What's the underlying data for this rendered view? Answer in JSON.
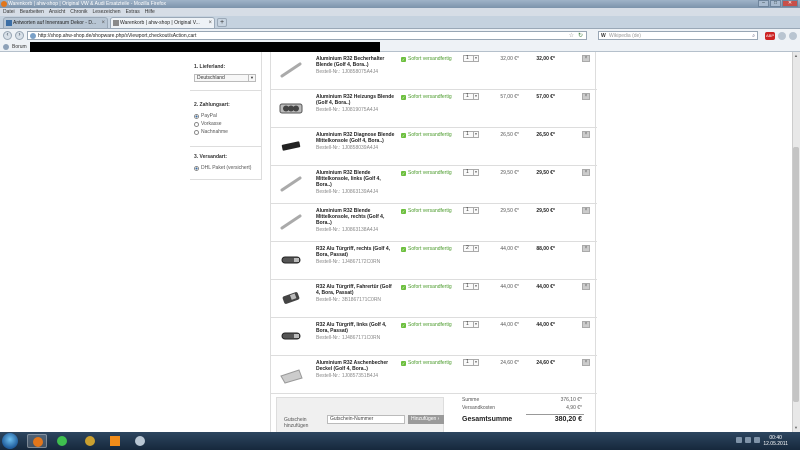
{
  "window": {
    "title": "Warenkorb | ahw-shop | Original VW & Audi Ersatzteile - Mozilla Firefox",
    "controls": [
      "–",
      "□",
      "✕"
    ]
  },
  "menubar": [
    "Datei",
    "Bearbeiten",
    "Ansicht",
    "Chronik",
    "Lesezeichen",
    "Extras",
    "Hilfe"
  ],
  "tabs": [
    {
      "label": "Antworten auf Innenraum Dekor - D...",
      "active": false
    },
    {
      "label": "Warenkorb | ahw-shop | Original V...",
      "active": true
    }
  ],
  "nav": {
    "url": "http://shop.ahw-shop.de/shopware.php/sViewport,checkout/sAction,cart",
    "search_placeholder": "Wikipedia (de)",
    "search_prefix": "W",
    "abp": "ABP"
  },
  "bookmarks": {
    "item": "Borum"
  },
  "sidebar": {
    "country_title": "1. Lieferland:",
    "country_value": "Deutschland",
    "payment_title": "2. Zahlungsart:",
    "payment_options": [
      {
        "label": "PayPal",
        "selected": true
      },
      {
        "label": "Vorkasse",
        "selected": false
      },
      {
        "label": "Nachnahme",
        "selected": false
      }
    ],
    "shipping_title": "3. Versandart:",
    "shipping_options": [
      {
        "label": "DHL Paket (versichert)",
        "selected": true
      }
    ]
  },
  "availability_label": "Sofort versandfertig",
  "cart_items": [
    {
      "name": "Aluminium R32 Becherhalter Blende (Golf 4, Bora..)",
      "number": "Bestell-Nr.: 1J0858075A4J4",
      "qty": "1",
      "unit_price": "32,00 €*",
      "total": "32,00 €*",
      "thumb": "rod"
    },
    {
      "name": "Aluminium R32 Heizungs Blende (Golf 4, Bora..)",
      "number": "Bestell-Nr.: 1J0819075A4J4",
      "qty": "1",
      "unit_price": "57,00 €*",
      "total": "57,00 €*",
      "thumb": "panel"
    },
    {
      "name": "Aluminium R32 Diagnose Blende Mittelkonsole (Golf 4, Bora..)",
      "number": "Bestell-Nr.: 1J0858039A4J4",
      "qty": "1",
      "unit_price": "26,50 €*",
      "total": "26,50 €*",
      "thumb": "dark"
    },
    {
      "name": "Aluminium R32 Blende Mittelkonsole, links (Golf 4, Bora..)",
      "number": "Bestell-Nr.: 1J0863139A4J4",
      "qty": "1",
      "unit_price": "29,50 €*",
      "total": "29,50 €*",
      "thumb": "rod"
    },
    {
      "name": "Aluminium R32 Blende Mittelkonsole, rechts (Golf 4, Bora..)",
      "number": "Bestell-Nr.: 1J0863138A4J4",
      "qty": "1",
      "unit_price": "29,50 €*",
      "total": "29,50 €*",
      "thumb": "rod"
    },
    {
      "name": "R32 Alu Türgriff, rechts (Golf 4, Bora, Passat)",
      "number": "Bestell-Nr.: 1J4867172C0RN",
      "qty": "2",
      "unit_price": "44,00 €*",
      "total": "88,00 €*",
      "thumb": "handle"
    },
    {
      "name": "R32 Alu Türgriff, Fahrertür (Golf 4, Bora, Passat)",
      "number": "Bestell-Nr.: 3B1867171C0RN",
      "qty": "1",
      "unit_price": "44,00 €*",
      "total": "44,00 €*",
      "thumb": "handle2"
    },
    {
      "name": "R32 Alu Türgriff, links (Golf 4, Bora, Passat)",
      "number": "Bestell-Nr.: 1J4867171C0RN",
      "qty": "1",
      "unit_price": "44,00 €*",
      "total": "44,00 €*",
      "thumb": "handle"
    },
    {
      "name": "Aluminium R32 Aschenbecher Deckel (Golf 4, Bora..)",
      "number": "Bestell-Nr.: 1J0857351B4J4",
      "qty": "1",
      "unit_price": "24,60 €*",
      "total": "24,60 €*",
      "thumb": "flat"
    }
  ],
  "voucher": {
    "label": "Gutschein hinzufügen",
    "placeholder": "Gutschein-Nummer",
    "button": "Hinzufügen ›"
  },
  "summary": {
    "subtotal_label": "Summe",
    "subtotal": "376,10 €*",
    "shipping_label": "Versandkosten",
    "shipping": "4,90 €*",
    "total_label": "Gesamtsumme",
    "total": "380,20 €"
  },
  "taskbar": {
    "time": "00:40",
    "date": "12.05.2011"
  }
}
